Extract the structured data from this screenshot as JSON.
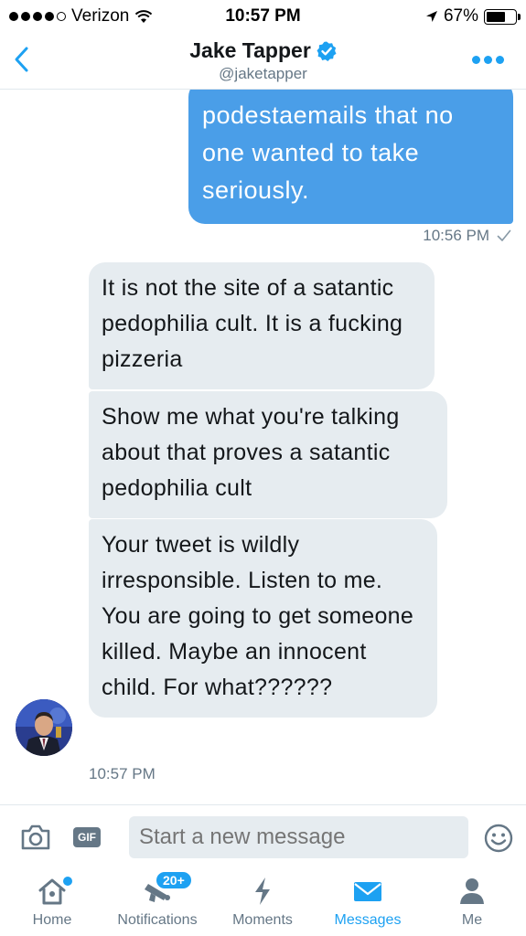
{
  "status_bar": {
    "carrier": "Verizon",
    "time": "10:57 PM",
    "battery": "67%",
    "battery_level": 0.67,
    "signal_bars": 4,
    "icons": [
      "signal-dots-icon",
      "wifi-icon",
      "location-arrow-icon",
      "battery-icon"
    ]
  },
  "header": {
    "name": "Jake Tapper",
    "handle": "@jaketapper",
    "verified": true,
    "icons": [
      "back-chevron-icon",
      "verified-badge-icon",
      "more-options-icon"
    ]
  },
  "messages": {
    "outgoing": [
      {
        "text": "podestaemails that no one wanted to take seriously.",
        "time": "10:56 PM"
      }
    ],
    "incoming": [
      {
        "text": "It is not the site of a satantic pedophilia cult. It is a fucking pizzeria"
      },
      {
        "text": "Show me what you're talking about that proves a satantic pedophilia cult"
      },
      {
        "text": "Your tweet is wildly irresponsible. Listen to me. You are going to get someone killed. Maybe an innocent child. For what??????"
      }
    ],
    "incoming_time": "10:57 PM"
  },
  "composer": {
    "placeholder": "Start a new message",
    "gif_label": "GIF",
    "icons": [
      "camera-icon",
      "gif-icon",
      "emoji-icon"
    ]
  },
  "tabs": [
    {
      "label": "Home",
      "icon": "home-icon",
      "active": false,
      "dot": true
    },
    {
      "label": "Notifications",
      "icon": "bell-icon",
      "active": false,
      "badge": "20+"
    },
    {
      "label": "Moments",
      "icon": "lightning-icon",
      "active": false
    },
    {
      "label": "Messages",
      "icon": "envelope-icon",
      "active": true
    },
    {
      "label": "Me",
      "icon": "person-icon",
      "active": false
    }
  ],
  "colors": {
    "accent": "#1da1f2",
    "outgoing_bubble": "#4a9ee8",
    "incoming_bubble": "#e6ecf0",
    "muted_text": "#657786"
  }
}
